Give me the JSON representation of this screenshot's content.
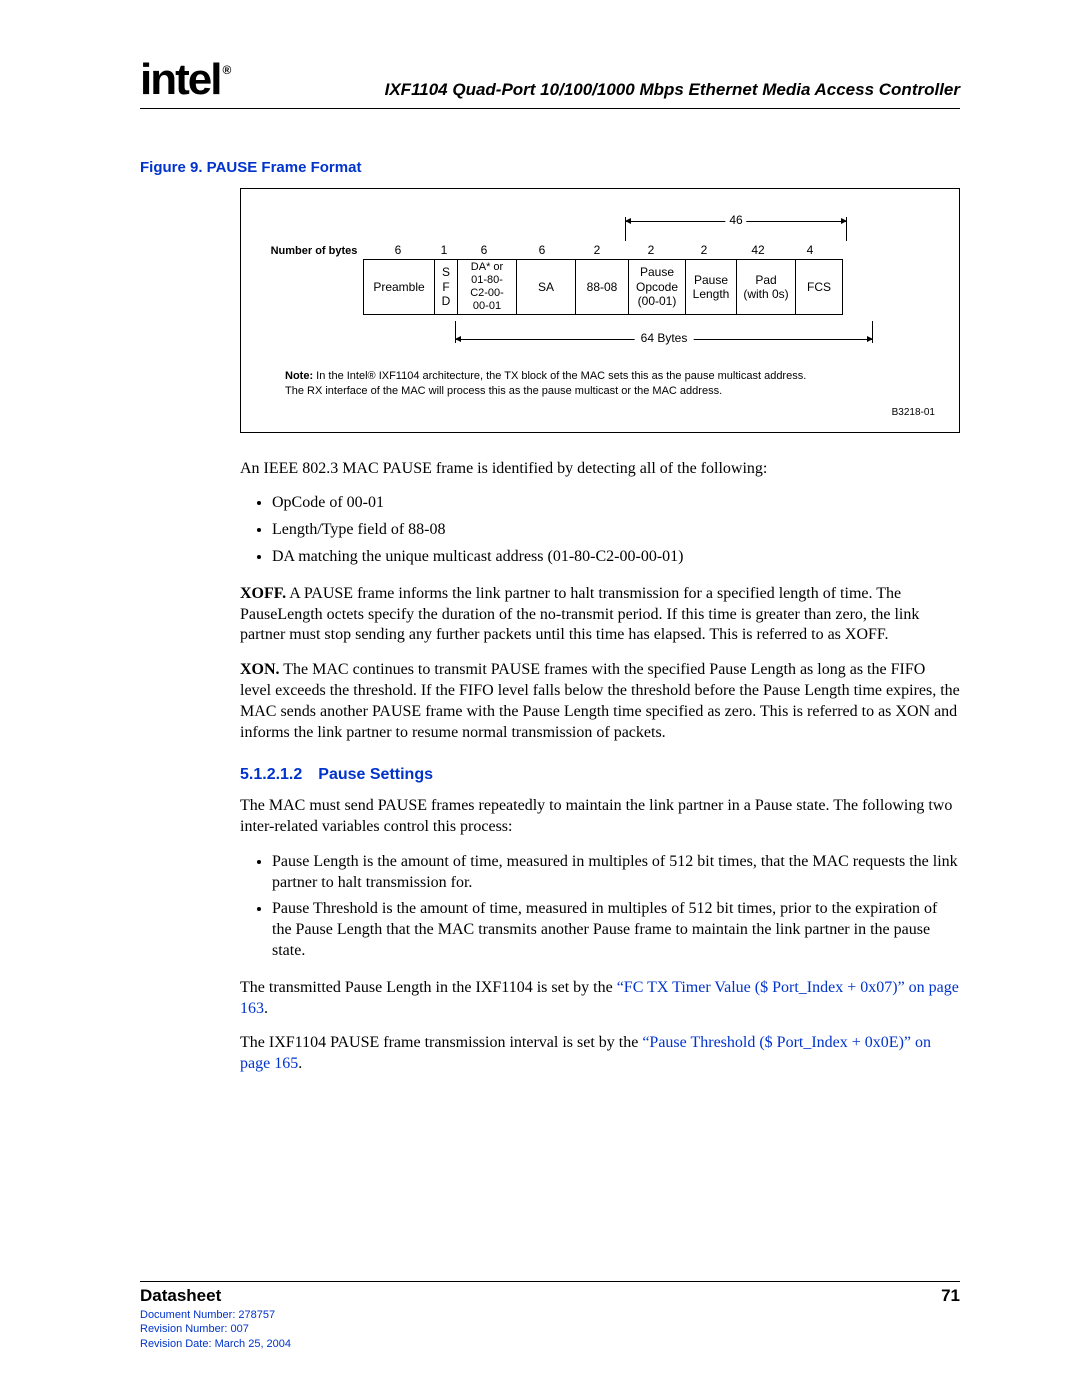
{
  "header": {
    "logo_text": "intel",
    "reg_mark": "®",
    "doc_title": "IXF1104 Quad-Port 10/100/1000 Mbps Ethernet Media Access Controller"
  },
  "figure": {
    "caption": "Figure 9. PAUSE Frame Format",
    "number_of_bytes_label": "Number of bytes",
    "top_dim_label": "46",
    "byte_counts": [
      "6",
      "1",
      "6",
      "6",
      "2",
      "2",
      "2",
      "42",
      "4"
    ],
    "cells": {
      "preamble": "Preamble",
      "sfd": "S\nF\nD",
      "da": "DA* or\n01-80-\nC2-00-\n00-01",
      "sa": "SA",
      "lt": "88-08",
      "opcode": "Pause\nOpcode\n(00-01)",
      "plen": "Pause\nLength",
      "pad": "Pad\n(with 0s)",
      "fcs": "FCS"
    },
    "bottom_dim_label": "64 Bytes",
    "note_prefix": "Note:",
    "note_body": " In the Intel® IXF1104 architecture, the TX block of the MAC sets this as the pause multicast address.\nThe RX interface of the MAC will process this as the pause multicast or the MAC address.",
    "fig_id": "B3218-01"
  },
  "body": {
    "intro": "An IEEE 802.3 MAC PAUSE frame is identified by detecting all of the following:",
    "detect_list": [
      "OpCode of 00-01",
      "Length/Type field of 88-08",
      "DA matching the unique multicast address (01-80-C2-00-00-01)"
    ],
    "xoff_label": "XOFF.",
    "xoff_text": " A PAUSE frame informs the link partner to halt transmission for a specified length of time. The PauseLength octets specify the duration of the no-transmit period. If this time is greater than zero, the link partner must stop sending any further packets until this time has elapsed. This is referred to as XOFF.",
    "xon_label": "XON.",
    "xon_text": " The MAC continues to transmit PAUSE frames with the specified Pause Length as long as the FIFO level exceeds the threshold. If the FIFO level falls below the threshold before the Pause Length time expires, the MAC sends another PAUSE frame with the Pause Length time specified as zero. This is referred to as XON and informs the link partner to resume normal transmission of packets.",
    "sec_num": "5.1.2.1.2",
    "sec_title": "Pause Settings",
    "ps_intro": "The MAC must send PAUSE frames repeatedly to maintain the link partner in a Pause state. The following two inter-related variables control this process:",
    "ps_list": [
      "Pause Length is the amount of time, measured in multiples of 512 bit times, that the MAC requests the link partner to halt transmission for.",
      "Pause Threshold is the amount of time, measured in multiples of 512 bit times, prior to the expiration of the Pause Length that the MAC transmits another Pause frame to maintain the link partner in the pause state."
    ],
    "tx_timer_pre": "The transmitted Pause Length in the IXF1104 is set by the ",
    "tx_timer_link": "“FC TX Timer Value ($ Port_Index + 0x07)” on page 163",
    "tx_timer_post": ".",
    "pt_pre": "The IXF1104 PAUSE frame transmission interval is set by the ",
    "pt_link": "“Pause Threshold ($ Port_Index + 0x0E)” on page 165",
    "pt_post": "."
  },
  "footer": {
    "datasheet": "Datasheet",
    "page": "71",
    "doc_num": "Document Number: 278757",
    "rev_num": "Revision Number: 007",
    "rev_date": "Revision Date: March 25, 2004"
  }
}
